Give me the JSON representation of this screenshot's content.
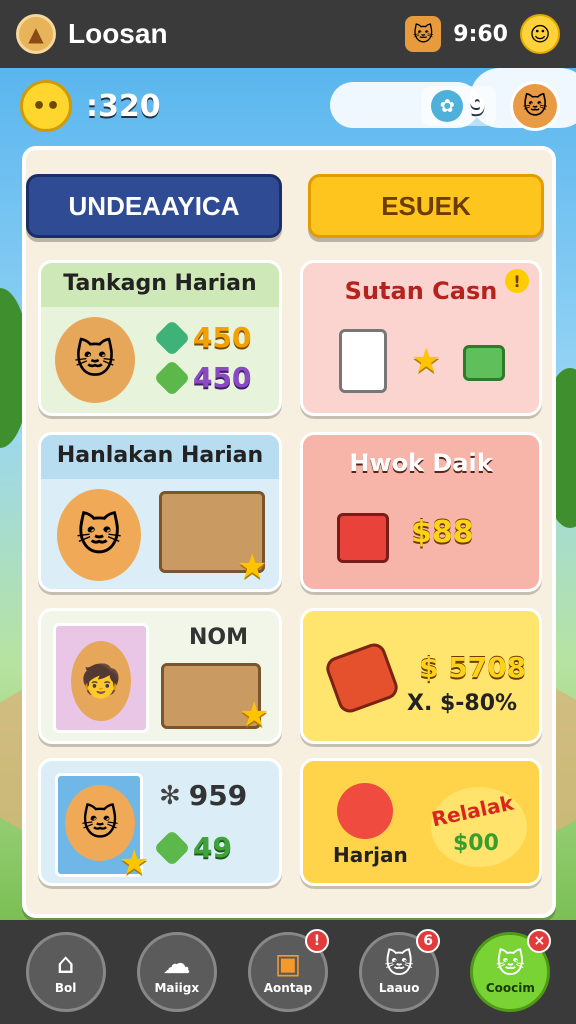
{
  "status_bar": {
    "app_title": "Loosan",
    "time": "9:60",
    "app_icon": "acorn-icon",
    "cat_icon": "cat-icon",
    "profile_icon": "smiley-icon"
  },
  "resources": {
    "coins": ":320",
    "gems": "9",
    "coin_icon": "coin-icon",
    "gem_icon": "gem-icon"
  },
  "tabs": [
    {
      "label": "UNDEAAYICA"
    },
    {
      "label": "ESUEK"
    }
  ],
  "cards": {
    "left": [
      {
        "title": "Tankagn Harian",
        "stats": [
          "450",
          "450"
        ]
      },
      {
        "title": "Hanlakan Harian"
      },
      {
        "title": "NOM"
      },
      {
        "stats": [
          "959",
          "49"
        ]
      }
    ],
    "right": [
      {
        "title": "Sutan Casn",
        "alert": "!"
      },
      {
        "title": "Hwok Daik",
        "price": "$88"
      },
      {
        "price": "$ 5708",
        "subprice": "X. $-80%"
      },
      {
        "label": "Harjan",
        "burst": "Relalak",
        "burst_value": "$00"
      }
    ]
  },
  "bottom_nav": [
    {
      "label": "Bol",
      "icon": "home-icon",
      "badge": ""
    },
    {
      "label": "Maiigx",
      "icon": "cloud-icon",
      "badge": ""
    },
    {
      "label": "Aontap",
      "icon": "bag-icon",
      "badge": "!"
    },
    {
      "label": "Laauo",
      "icon": "cat-face-icon",
      "badge": "6"
    },
    {
      "label": "Coocim",
      "icon": "cat-face-icon",
      "badge": "×"
    }
  ],
  "colors": {
    "tab_blue": "#2e4b94",
    "tab_yellow": "#ffc51f",
    "nav_active": "#7ad334",
    "badge_red": "#e23b3b"
  }
}
